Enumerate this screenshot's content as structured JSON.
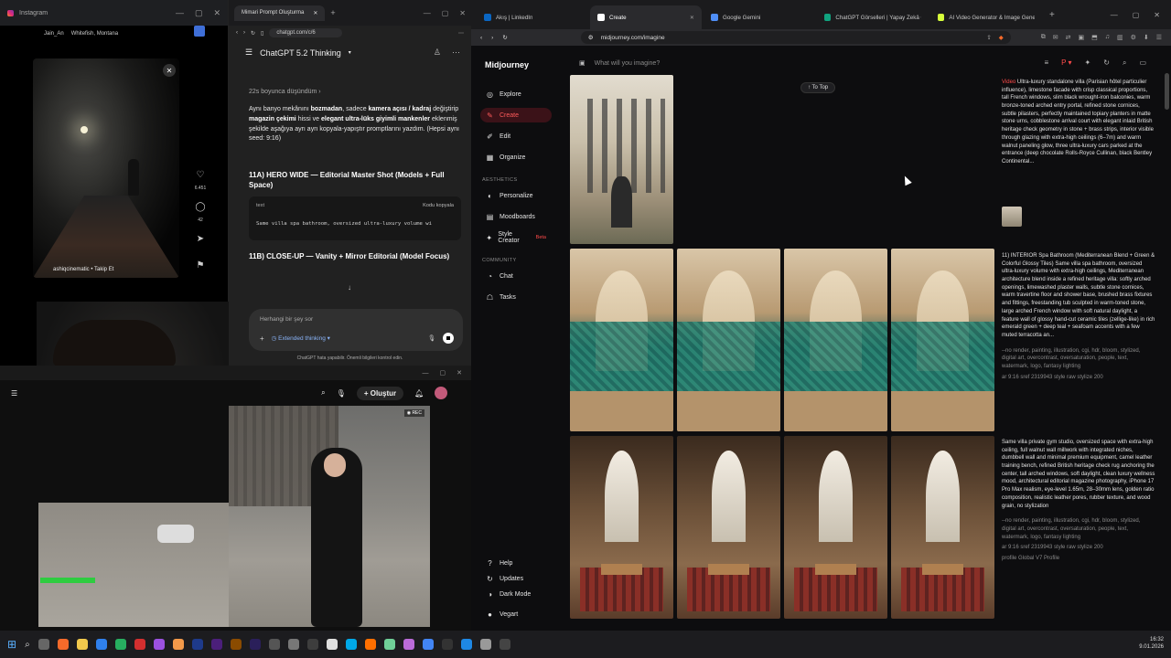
{
  "instagram": {
    "title": "Instagram",
    "badge_user": "Jain_An",
    "badge_location": "Whitefish, Montana",
    "likes": "6.451",
    "comments": "42",
    "user": "ashiqcinematic",
    "follow": "Takip Et",
    "colors": {
      "bg": "#000000"
    }
  },
  "chatgpt": {
    "tab_title": "Mimari Prompt Oluşturma",
    "url": "chatgpt.com/c/6",
    "model": "ChatGPT 5.2 Thinking",
    "thought": "22s boyunca düşündüm",
    "intro_pre": "Aynı banyo mekânını ",
    "intro_b1": "bozmadan",
    "intro_mid1": ", sadece ",
    "intro_b2": "kamera açısı / kadraj",
    "intro_mid2": " değiştirip ",
    "intro_b3": "magazin çekimi",
    "intro_mid3": " hissi ve ",
    "intro_b4": "elegant ultra-lüks giyimli mankenler",
    "intro_post": " eklenmiş şekilde aşağıya ayrı ayrı kopyala-yapıştır promptlarını yazdım. (Hepsi aynı seed: 9:16)",
    "section_a": "11A) HERO WIDE — Editorial Master Shot (Models + Full Space)",
    "code_lang": "text",
    "copy_label": "Kodu kopyala",
    "code_line": "Same villa spa bathroom, oversized ultra-luxury volume wi",
    "section_b": "11B) CLOSE-UP — Vanity + Mirror Editorial (Model Focus)",
    "input_placeholder": "Herhangi bir şey sor",
    "extended": "Extended thinking",
    "disclaimer": "ChatGPT hata yapabilir. Önemli bilgileri kontrol edin."
  },
  "youtube": {
    "create": "Oluştur"
  },
  "browser": {
    "tabs": [
      {
        "label": "Akış | LinkedIn",
        "color": "#0a66c2"
      },
      {
        "label": "Create",
        "color": "#ffffff",
        "active": true
      },
      {
        "label": "Google Gemini",
        "color": "#4f8ef7"
      },
      {
        "label": "ChatGPT Görselleri | Yapay Zekâ Gö",
        "color": "#10a37f"
      },
      {
        "label": "AI Video Generator & Image Generat",
        "color": "#d6ff3a"
      }
    ],
    "url": "midjourney.com/imagine"
  },
  "midjourney": {
    "brand": "Midjourney",
    "nav": [
      {
        "label": "Explore",
        "icon": "◎"
      },
      {
        "label": "Create",
        "icon": "✎",
        "active": true
      },
      {
        "label": "Edit",
        "icon": "✐"
      },
      {
        "label": "Organize",
        "icon": "▦"
      }
    ],
    "aesthetics_label": "AESTHETICS",
    "aesthetics": [
      {
        "label": "Personalize",
        "icon": "◐"
      },
      {
        "label": "Moodboards",
        "icon": "▤"
      },
      {
        "label": "Style Creator",
        "icon": "✦",
        "beta": "Beta"
      }
    ],
    "community_label": "COMMUNITY",
    "community": [
      {
        "label": "Chat",
        "icon": "◔"
      },
      {
        "label": "Tasks",
        "icon": "☖"
      }
    ],
    "bottom": [
      {
        "label": "Help",
        "icon": "?"
      },
      {
        "label": "Updates",
        "icon": "↻"
      },
      {
        "label": "Dark Mode",
        "icon": "◑"
      },
      {
        "label": "Vegart",
        "icon": "●"
      }
    ],
    "search_placeholder": "What will you imagine?",
    "to_top": "↑ To Top",
    "prompt1_tag": "Video",
    "prompt1": "Ultra-luxury standalone villa (Parisian hôtel particulier influence), limestone facade with crisp classical proportions, tall French windows, slim black wrought-iron balconies, warm bronze-toned arched entry portal, refined stone cornices, subtle pilasters, perfectly maintained topiary planters in matte stone urns, cobblestone arrival court with elegant inlaid British heritage check geometry in stone + brass strips, interior visible through glazing with extra-high ceilings (6–7m) and warm walnut paneling glow, three ultra-luxury cars parked at the entrance (deep chocolate Rolls-Royce Cullinan, black Bentley Continental...",
    "prompt2": "11) INTERIOR Spa Bathroom (Mediterranean Blend + Green & Colorful Glossy Tiles) Same villa spa bathroom, oversized ultra-luxury volume with extra-high ceilings, Mediterranean architecture blend inside a refined heritage villa: softly arched openings, limewashed plaster walls, subtle stone cornices, warm travertine floor and shower base, brushed brass fixtures and fittings, freestanding tub sculpted in warm-toned stone, large arched French window with soft natural daylight, a feature wall of glossy hand-cut ceramic tiles (zellige-like) in rich emerald green + deep teal + seafoam accents with a few muted terracotta an...",
    "prompt2_meta": "--no render, painting, illustration, cgi, hdr, bloom, stylized, digital art, overcontrast, oversaturation, people, text, watermark, logo, fantasy lighting",
    "prompt2_params": "ar 9:16   sref 2319943   style raw   stylize 200",
    "prompt3": "Same villa private gym studio, oversized space with extra-high ceiling, full walnut wall millwork with integrated niches, dumbbell wall and minimal premium equipment, camel leather training bench, refined British heritage check rug anchoring the center, tall arched windows, soft daylight, clean luxury wellness mood, architectural editorial magazine photography, iPhone 17 Pro Max realism, eye-level 1.65m, 28–30mm lens, golden ratio composition, realistic leather pores, rubber texture, and wood grain, no stylization",
    "prompt3_meta": "--no render, painting, illustration, cgi, hdr, bloom, stylized, digital art, overcontrast, oversaturation, people, text, watermark, logo, fantasy lighting",
    "prompt3_params": "ar 9:16   sref 2319943   style raw   stylize 200",
    "prompt3_profile": "profile Global V7 Profile",
    "colors": {
      "accent": "#ff4a4a",
      "bg": "#0d0d0f"
    }
  },
  "taskbar": {
    "time": "16:32",
    "date": "9.01.2026"
  }
}
